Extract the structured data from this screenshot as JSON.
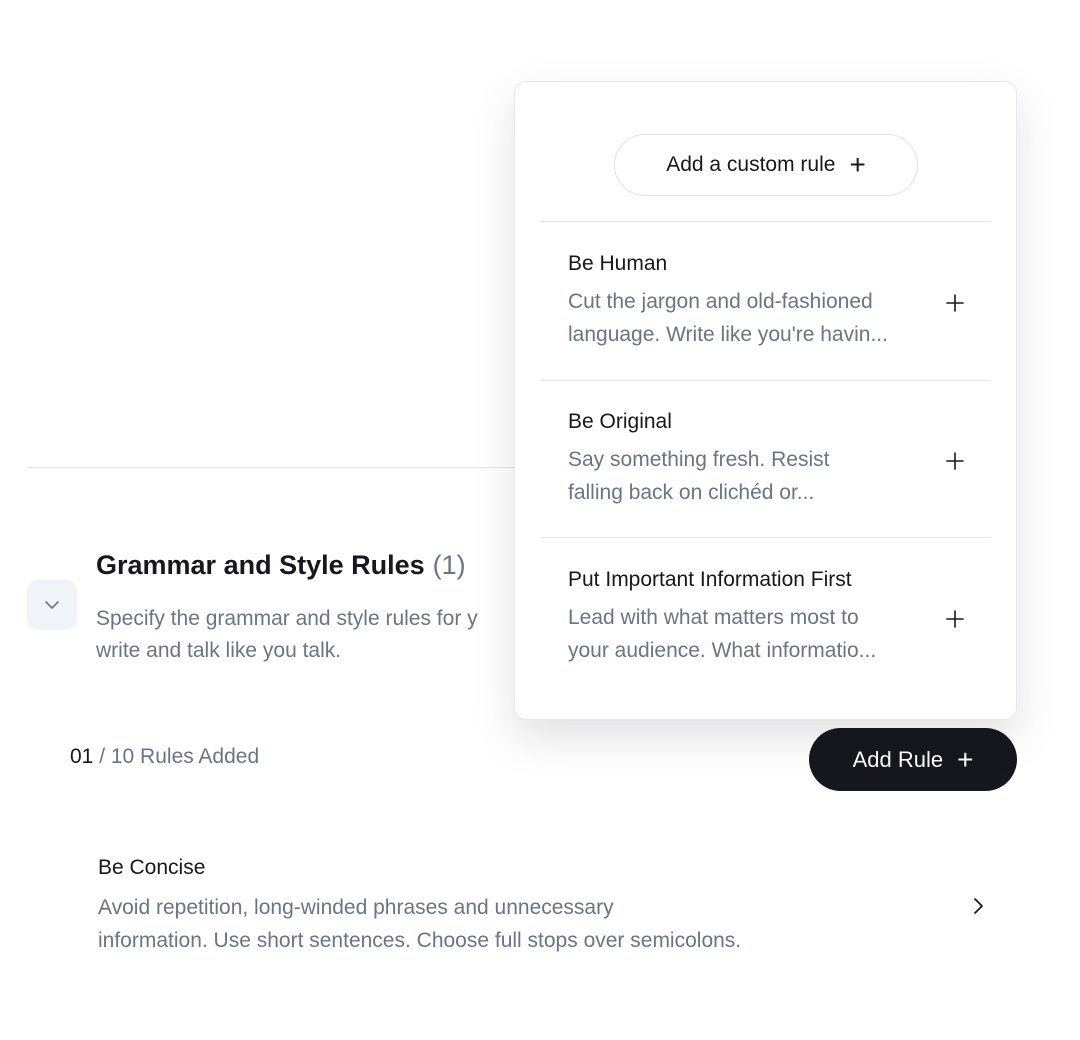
{
  "section": {
    "title": "Grammar and Style Rules",
    "count": "(1)",
    "description": "Specify the grammar and style rules for y write and talk like you talk.",
    "description_line1": "Specify the grammar and style rules for y",
    "description_line2": "write and talk like you talk."
  },
  "rules_counter": {
    "current": "01",
    "rest": " / 10 Rules Added"
  },
  "add_rule_button": {
    "label": "Add Rule",
    "icon": "plus-icon"
  },
  "added_rules": [
    {
      "title": "Be Concise",
      "description_line1": "Avoid repetition, long-winded phrases and unnecessary",
      "description_line2": "information. Use short sentences. Choose full stops over semicolons.",
      "icon": "chevron-right-icon"
    }
  ],
  "dropdown": {
    "custom_rule_label": "Add a custom rule",
    "items": [
      {
        "title": "Be Human",
        "description_line1": "Cut the jargon and old-fashioned",
        "description_line2": "language. Write like you're havin..."
      },
      {
        "title": "Be Original",
        "description_line1": "Say something fresh. Resist",
        "description_line2": "falling back on clichéd or..."
      },
      {
        "title": "Put Important Information First",
        "description_line1": "Lead with what matters most to",
        "description_line2": "your audience. What informatio..."
      }
    ]
  },
  "colors": {
    "text_primary": "#16181d",
    "text_secondary": "#6b7486",
    "button_dark": "#16181d",
    "collapse_bg": "#f0f3f8"
  }
}
